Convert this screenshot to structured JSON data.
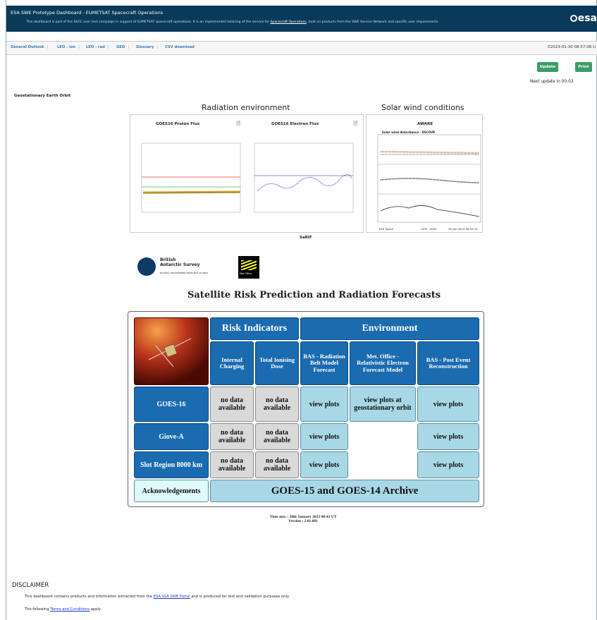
{
  "header": {
    "title": "ESA SWE Prototype Dashboard - EUMETSAT Spacecraft Operations",
    "subtitle_pre": "This dashboard is part of the SSCC user test campaign in support of EUMETSAT spacecraft operations. It is an implemented tailoring of the service for ",
    "subtitle_link": "Spacecraft Operations",
    "subtitle_post": ", built on products from the SWE Service Network and specific user requirements.",
    "logo": "esa"
  },
  "tabs": [
    "General Outlook",
    "LEO - ion",
    "LEO - rad",
    "GEO",
    "Glossary",
    "CSV download"
  ],
  "timestamp": "⏲2023-01-30 08:57:08 U",
  "buttons": {
    "update": "Update",
    "print": "Print"
  },
  "next_update": "Next update in 00:03",
  "section_label": "Geostationary Earth Orbit",
  "radiation": {
    "title": "Radiation environment",
    "proton_title": "GOES16 Proton Flux",
    "electron_title": "GOES16 Electron Flux",
    "footer": "SaRIF"
  },
  "solar": {
    "title": "Solar wind conditions",
    "panel_title": "AWARE",
    "plot_label": "Solar wind disturbance - DSCOVR",
    "bottom_left": "ESS Space",
    "bottom_mid": "DOY - 2023",
    "bottom_right": "30-Jan-2023 08:52:14"
  },
  "logos": {
    "bas_line1": "British",
    "bas_line2": "Antarctic Survey",
    "bas_line3": "NATURAL ENVIRONMENT RESEARCH COUNCIL",
    "metoffice": "Met Office"
  },
  "srp": {
    "title": "Satellite Risk Prediction and Radiation Forecasts",
    "risk_header": "Risk Indicators",
    "env_header": "Environment",
    "col_internal": "Internal Charging",
    "col_tid": "Total Ionising Dose",
    "col_bas": "BAS - Radiation Belt Model Forecast",
    "col_met": "Met. Office - Relativistic Electron Forecast Model",
    "col_baspost": "BAS - Post Event Reconstruction",
    "rows": [
      {
        "name": "GOES-16",
        "internal": "no data available",
        "tid": "no data available",
        "bas": "view plots",
        "met": "view plots at geostationary orbit",
        "baspost": "view plots"
      },
      {
        "name": "Giove-A",
        "internal": "no data available",
        "tid": "no data available",
        "bas": "view plots",
        "met": "",
        "baspost": "view plots"
      },
      {
        "name": "Slot Region 8000 km",
        "internal": "no data available",
        "tid": "no data available",
        "bas": "view plots",
        "met": "",
        "baspost": "view plots"
      }
    ],
    "ack": "Acknowledgements",
    "archive": "GOES-15 and GOES-14 Archive",
    "time_now": "Time now : 30th January 2023 08:43 UT",
    "version": "Version : 2.01.001"
  },
  "disclaimer": {
    "title": "DISCLAIMER",
    "line1_pre": "This dashboard contains products and information extracted from the ",
    "line1_link": "ESA SSA SWE Portal",
    "line1_post": " and is produced for test and validation purposes only.",
    "line2_pre": "The following ",
    "line2_link": "Terms and Conditions",
    "line2_post": " apply."
  },
  "colors": {
    "header_bg": "#0a3a5a",
    "tab_text": "#3a7ab0",
    "green_button": "#3a9c6a",
    "cell_blue": "#1b6bb0",
    "cell_light": "#a8d8e6"
  }
}
